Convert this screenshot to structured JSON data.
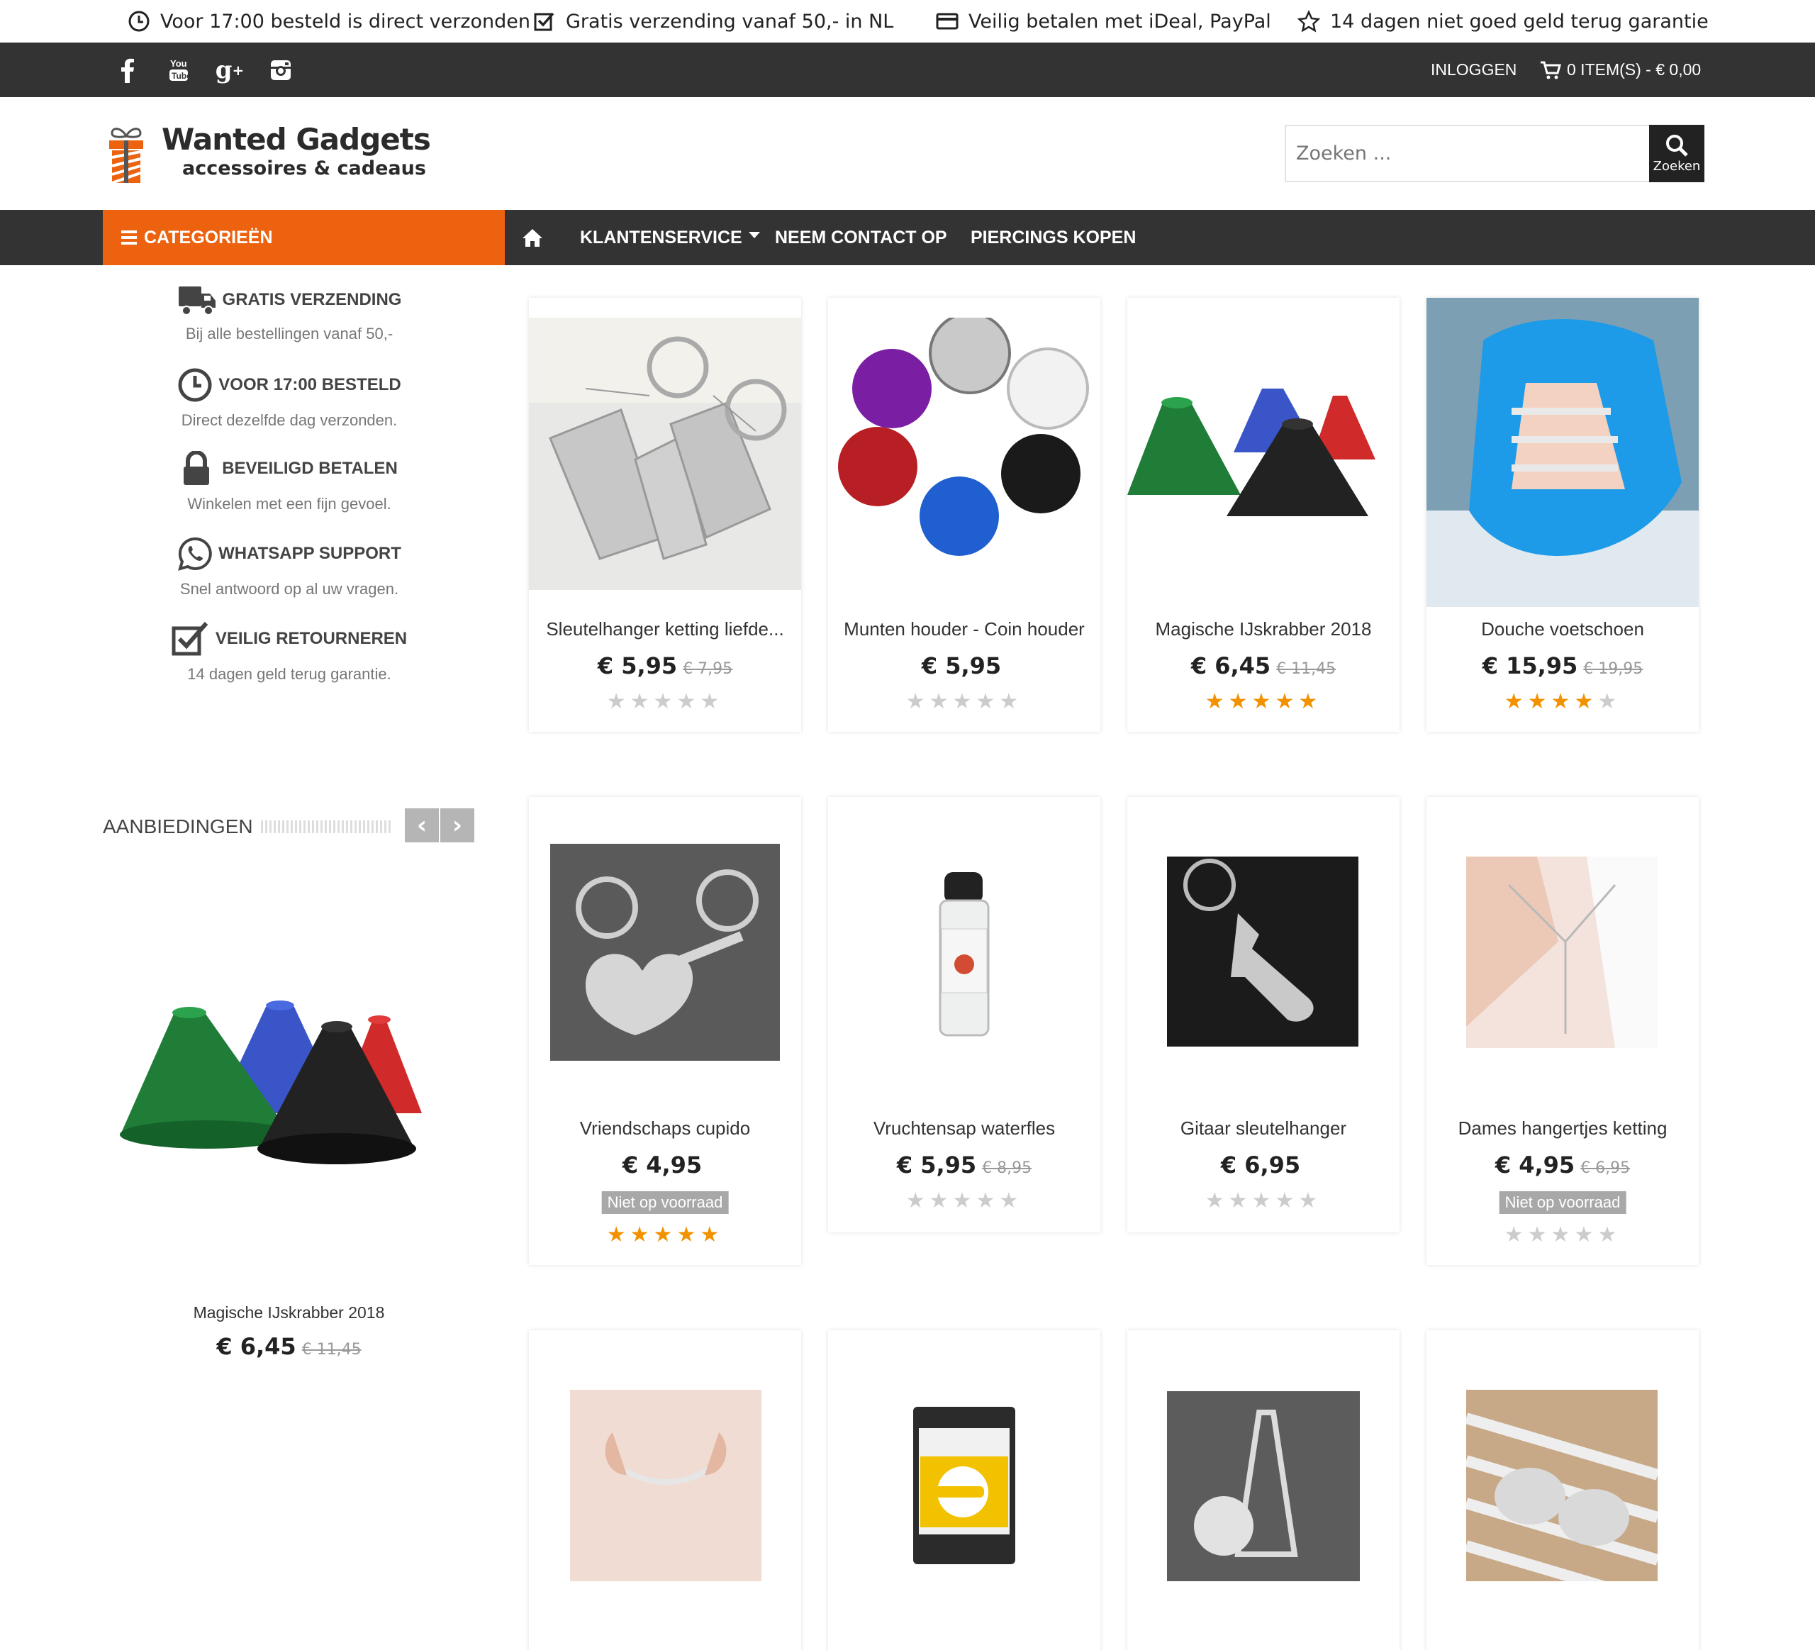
{
  "usp": [
    {
      "icon": "clock-icon",
      "text": "Voor 17:00 besteld is direct verzonden"
    },
    {
      "icon": "checkbox-icon",
      "text": "Gratis verzending vanaf 50,- in NL"
    },
    {
      "icon": "credit-card-icon",
      "text": "Veilig betalen met iDeal, PayPal"
    },
    {
      "icon": "star-outline-icon",
      "text": "14 dagen niet goed geld terug garantie"
    }
  ],
  "social": [
    "facebook-icon",
    "youtube-icon",
    "google-plus-icon",
    "instagram-icon"
  ],
  "topbar": {
    "login": "INLOGGEN",
    "cart": "0 ITEM(S) - € 0,00"
  },
  "logo": {
    "title": "Wanted Gadgets",
    "subtitle": "accessoires & cadeaus"
  },
  "search": {
    "placeholder": "Zoeken ...",
    "button": "Zoeken"
  },
  "nav": {
    "categories": "CATEGORIEËN",
    "items": [
      "KLANTENSERVICE",
      "NEEM CONTACT OP",
      "PIERCINGS KOPEN"
    ]
  },
  "features": [
    {
      "icon": "truck-icon",
      "title": "GRATIS VERZENDING",
      "sub": "Bij alle bestellingen vanaf 50,-"
    },
    {
      "icon": "clock-icon",
      "title": "VOOR 17:00 BESTELD",
      "sub": "Direct dezelfde dag verzonden."
    },
    {
      "icon": "lock-icon",
      "title": "BEVEILIGD BETALEN",
      "sub": "Winkelen met een fijn gevoel."
    },
    {
      "icon": "whatsapp-icon",
      "title": "WHATSAPP SUPPORT",
      "sub": "Snel antwoord op al uw vragen."
    },
    {
      "icon": "checkbox-icon",
      "title": "VEILIG RETOURNEREN",
      "sub": "14 dagen geld terug garantie."
    }
  ],
  "offers": {
    "title": "AANBIEDINGEN",
    "item": {
      "name": "Magische IJskrabber 2018",
      "price": "€ 6,45",
      "old": "€ 11,45"
    }
  },
  "products": [
    {
      "name": "Sleutelhanger ketting liefde...",
      "price": "€ 5,95",
      "old": "€ 7,95",
      "stock": "",
      "rating": 0
    },
    {
      "name": "Munten houder - Coin houder",
      "price": "€ 5,95",
      "old": "",
      "stock": "",
      "rating": 0
    },
    {
      "name": "Magische IJskrabber 2018",
      "price": "€ 6,45",
      "old": "€ 11,45",
      "stock": "",
      "rating": 5
    },
    {
      "name": "Douche voetschoen",
      "price": "€ 15,95",
      "old": "€ 19,95",
      "stock": "",
      "rating": 4
    },
    {
      "name": "Vriendschaps cupido",
      "price": "€ 4,95",
      "old": "",
      "stock": "Niet op voorraad",
      "rating": 5
    },
    {
      "name": "Vruchtensap waterfles",
      "price": "€ 5,95",
      "old": "€ 8,95",
      "stock": "",
      "rating": 0
    },
    {
      "name": "Gitaar sleutelhanger",
      "price": "€ 6,95",
      "old": "",
      "stock": "",
      "rating": 0
    },
    {
      "name": "Dames hangertjes ketting",
      "price": "€ 4,95",
      "old": "€ 6,95",
      "stock": "Niet op voorraad",
      "rating": 0
    }
  ],
  "colors": {
    "accent": "#ec620f",
    "dark": "#333333",
    "star": "#f39200"
  }
}
